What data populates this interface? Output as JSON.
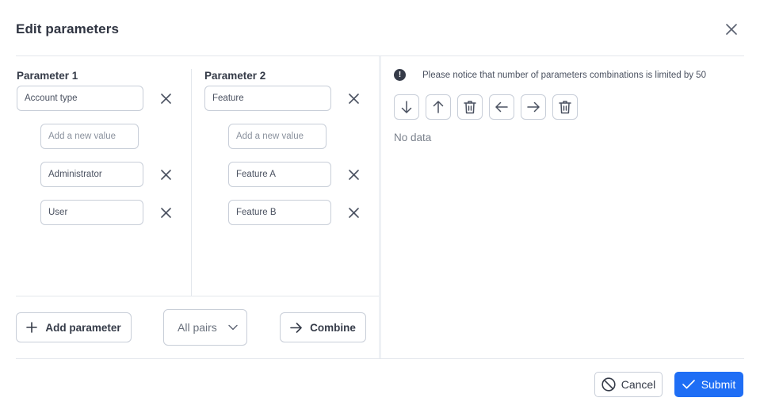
{
  "dialog": {
    "title": "Edit parameters",
    "close_icon": "close-icon"
  },
  "parameters": [
    {
      "label": "Parameter 1",
      "name_value": "Account type",
      "new_value_placeholder": "Add a new value",
      "values": [
        "Administrator",
        "User"
      ]
    },
    {
      "label": "Parameter 2",
      "name_value": "Feature",
      "new_value_placeholder": "Add a new value",
      "values": [
        "Feature A",
        "Feature B"
      ]
    }
  ],
  "actions": {
    "add_parameter_label": "Add parameter",
    "mode_select_value": "All pairs",
    "combine_label": "Combine"
  },
  "results": {
    "notice_text": "Please notice that number of parameters combinations is limited by 50",
    "toolbar": [
      {
        "name": "move-down",
        "icon": "arrow-down-icon"
      },
      {
        "name": "move-up",
        "icon": "arrow-up-icon"
      },
      {
        "name": "delete-row",
        "icon": "trash-icon"
      },
      {
        "name": "move-left",
        "icon": "arrow-left-icon"
      },
      {
        "name": "move-right",
        "icon": "arrow-right-icon"
      },
      {
        "name": "delete-column",
        "icon": "trash-icon"
      }
    ],
    "empty_text": "No data"
  },
  "footer": {
    "cancel_label": "Cancel",
    "submit_label": "Submit"
  },
  "colors": {
    "primary": "#1f6ef5",
    "text": "#353b48",
    "border": "#c8ced8"
  }
}
